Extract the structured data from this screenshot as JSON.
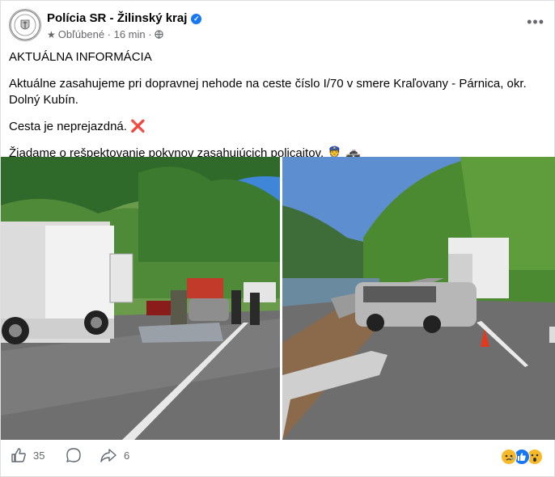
{
  "post": {
    "page_name": "Polícia SR - Žilinský kraj",
    "audience": "Obľúbené",
    "time": "16 min",
    "heading": "AKTUÁLNA INFORMÁCIA",
    "paragraph1": "Aktuálne zasahujeme pri dopravnej nehode na ceste číslo I/70 v smere Kraľovany - Párnica, okr. Dolný Kubín.",
    "paragraph2": "Cesta je neprejazdná. ❌",
    "paragraph3": "Žiadame o rešpektovanie pokynov zasahujúcich policajtov. 👮 🚓",
    "avatar_logo_text": "KRAJSKÉ RIADITEĽSTVO PZ ŽILINA"
  },
  "footer": {
    "likes": "35",
    "comments": "",
    "shares": "6",
    "reactions": [
      "sad",
      "like",
      "wow"
    ]
  },
  "colors": {
    "accent": "#1877f2",
    "secondary_text": "#65676b"
  },
  "icons": [
    "verified-icon",
    "star-icon",
    "globe-icon",
    "more-icon",
    "like-icon",
    "comment-icon",
    "share-icon"
  ]
}
